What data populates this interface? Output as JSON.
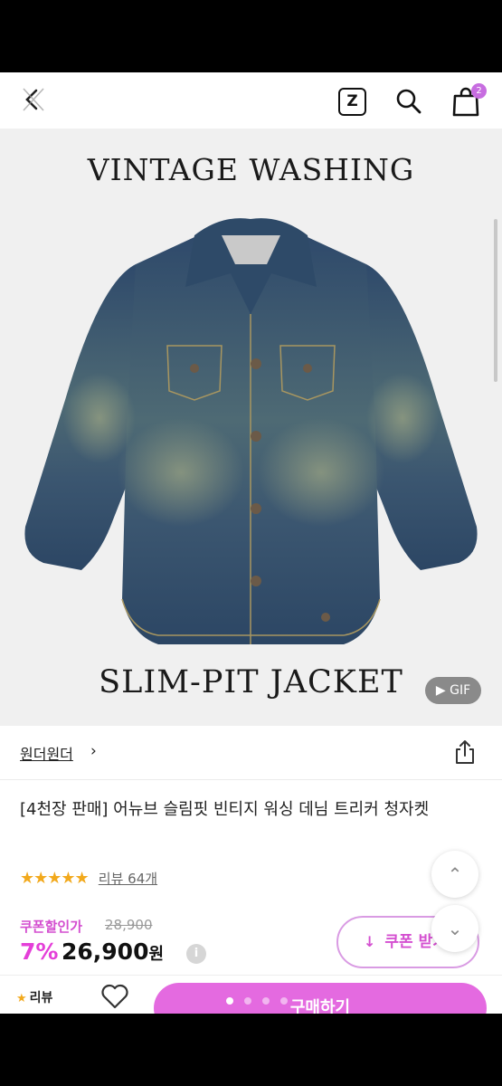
{
  "header": {
    "z_label": "Z",
    "cart_count": "2"
  },
  "hero": {
    "title_top": "VINTAGE WASHING",
    "title_bottom": "SLIM-PIT JACKET",
    "gif_label": "▶ GIF"
  },
  "store": {
    "name": "원더원더",
    "chevron": "›"
  },
  "product": {
    "name": "[4천장 판매] 어뉴브 슬림핏 빈티지 워싱 데님 트리커 청자켓",
    "stars": "★★★★★",
    "rating": 4.5,
    "review_count_label": "리뷰 64개"
  },
  "price": {
    "coupon_label": "쿠폰할인가",
    "original": "28,900",
    "discount": "7%",
    "final": "26,900",
    "currency": "원",
    "info": "i"
  },
  "coupon_button": {
    "icon": "↓",
    "label": "쿠폰 받기"
  },
  "floating": {
    "up": "⌃",
    "down": "⌄"
  },
  "bottom": {
    "review_tab": "리뷰",
    "buy_label": "구매하기"
  },
  "colors": {
    "accent": "#e46ae0",
    "star": "#f2a91c"
  }
}
